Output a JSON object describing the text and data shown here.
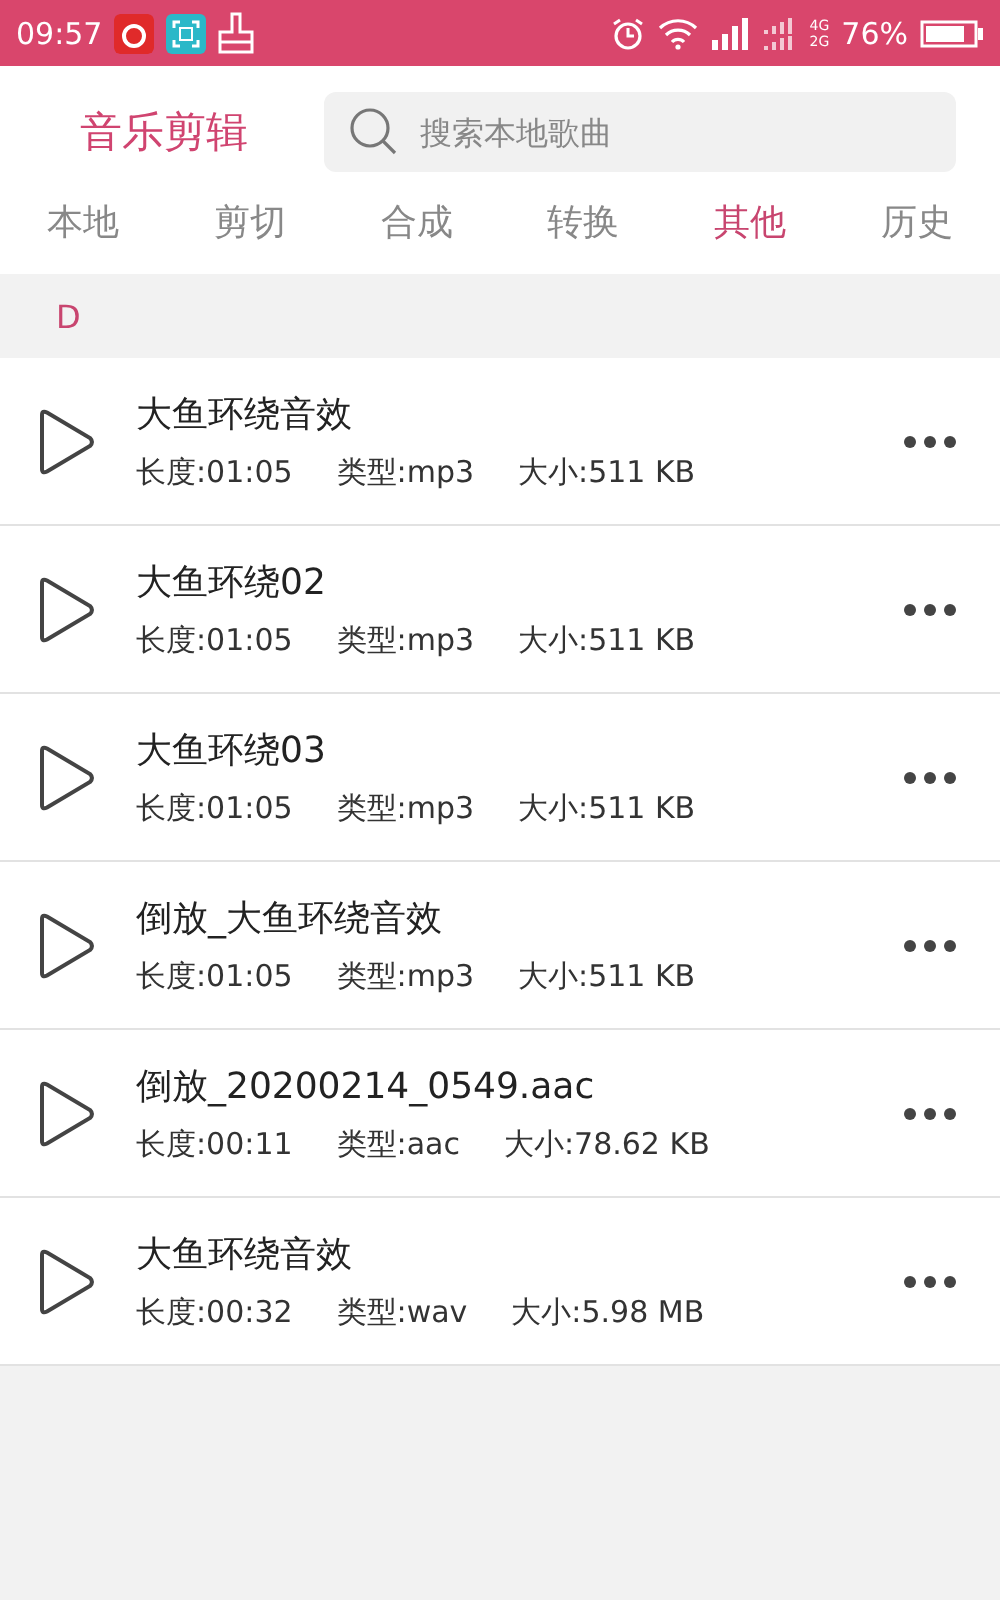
{
  "status_bar": {
    "time": "09:57",
    "network_top": "4G",
    "network_bottom": "2G",
    "battery": "76%"
  },
  "header": {
    "title": "音乐剪辑",
    "search": {
      "placeholder": "搜索本地歌曲"
    }
  },
  "tabs": [
    {
      "label": "本地",
      "selected": false
    },
    {
      "label": "剪切",
      "selected": false
    },
    {
      "label": "合成",
      "selected": false
    },
    {
      "label": "转换",
      "selected": false
    },
    {
      "label": "其他",
      "selected": true
    },
    {
      "label": "历史",
      "selected": false
    }
  ],
  "section": "D",
  "songs": [
    {
      "title": "大鱼环绕音效",
      "length": "长度:01:05",
      "type": "类型:mp3",
      "size": "大小:511 KB"
    },
    {
      "title": "大鱼环绕02",
      "length": "长度:01:05",
      "type": "类型:mp3",
      "size": "大小:511 KB"
    },
    {
      "title": "大鱼环绕03",
      "length": "长度:01:05",
      "type": "类型:mp3",
      "size": "大小:511 KB"
    },
    {
      "title": "倒放_大鱼环绕音效",
      "length": "长度:01:05",
      "type": "类型:mp3",
      "size": "大小:511 KB"
    },
    {
      "title": "倒放_20200214_0549.aac",
      "length": "长度:00:11",
      "type": "类型:aac",
      "size": "大小:78.62 KB"
    },
    {
      "title": "大鱼环绕音效",
      "length": "长度:00:32",
      "type": "类型:wav",
      "size": "大小:5.98 MB"
    }
  ]
}
